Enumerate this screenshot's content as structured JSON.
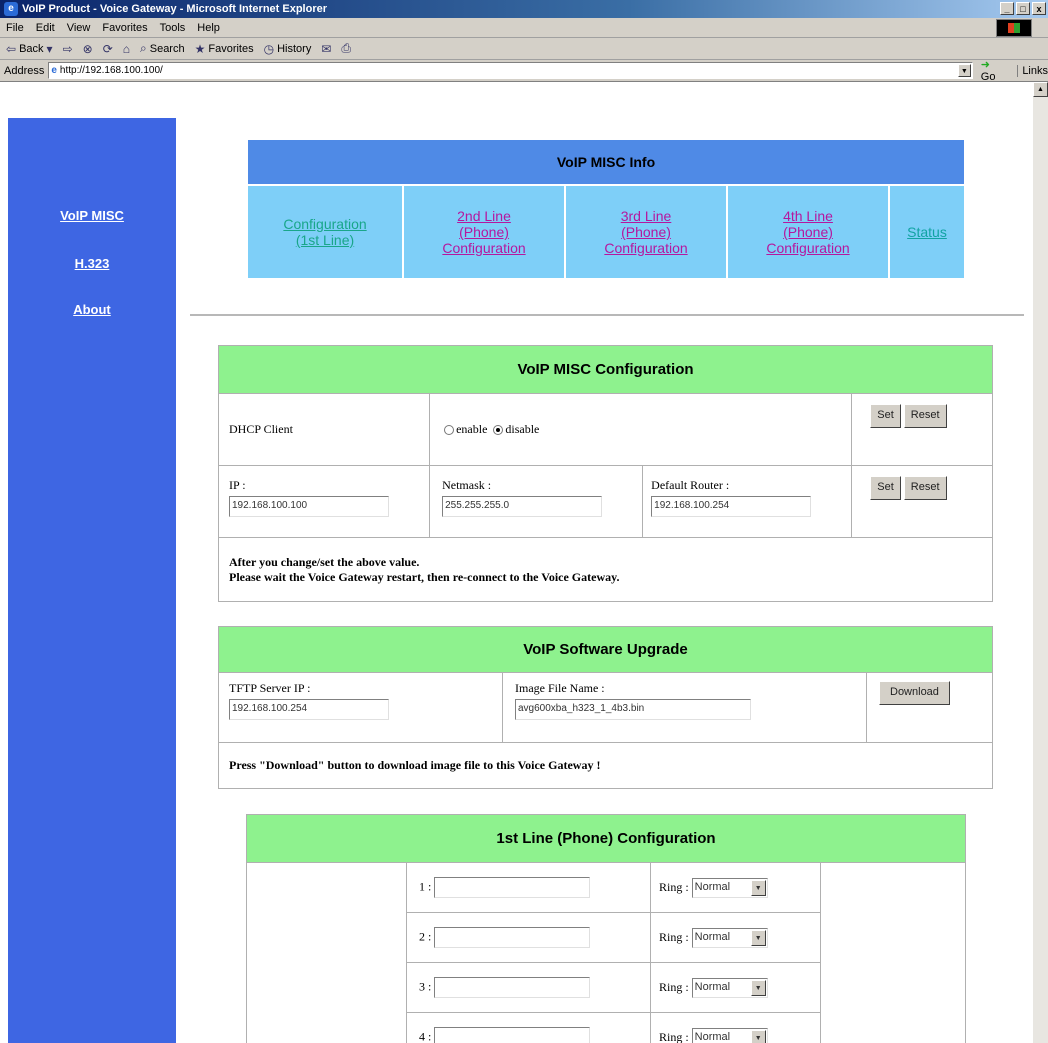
{
  "window": {
    "title": "VoIP Product - Voice Gateway - Microsoft Internet Explorer",
    "controls": [
      "_",
      "□",
      "x"
    ]
  },
  "menu": [
    "File",
    "Edit",
    "View",
    "Favorites",
    "Tools",
    "Help"
  ],
  "toolbar": {
    "back": "Back",
    "search": "Search",
    "favorites": "Favorites",
    "history": "History"
  },
  "address": {
    "label": "Address",
    "url": "http://192.168.100.100/",
    "go": "Go",
    "links": "Links"
  },
  "sidebar": {
    "items": [
      "VoIP MISC",
      "H.323",
      "About"
    ]
  },
  "info": {
    "title": "VoIP MISC Info",
    "tabs": [
      [
        "Configuration",
        "(1st Line)"
      ],
      [
        "2nd Line",
        "(Phone)",
        "Configuration"
      ],
      [
        "3rd Line",
        "(Phone)",
        "Configuration"
      ],
      [
        "4th Line",
        "(Phone)",
        "Configuration"
      ],
      [
        "Status"
      ]
    ]
  },
  "misc_config": {
    "title": "VoIP MISC Configuration",
    "dhcp_label": "DHCP Client",
    "enable_label": "enable",
    "disable_label": "disable",
    "dhcp_selected": "disable",
    "set_label": "Set",
    "reset_label": "Reset",
    "ip_label": "IP :",
    "ip_value": "192.168.100.100",
    "netmask_label": "Netmask :",
    "netmask_value": "255.255.255.0",
    "router_label": "Default Router :",
    "router_value": "192.168.100.254",
    "note_line1": "After you change/set the above value.",
    "note_line2": "Please wait the Voice Gateway restart, then re-connect to the Voice Gateway."
  },
  "upgrade": {
    "title": "VoIP Software Upgrade",
    "tftp_label": "TFTP Server IP :",
    "tftp_value": "192.168.100.254",
    "image_label": "Image File Name :",
    "image_value": "avg600xba_h323_1_4b3.bin",
    "download_label": "Download",
    "note": "Press \"Download\" button to download image file to this Voice Gateway !"
  },
  "line1": {
    "title": "1st Line (Phone) Configuration",
    "rows": [
      {
        "index": "1 :",
        "ring_label": "Ring :",
        "ring_value": "Normal"
      },
      {
        "index": "2 :",
        "ring_label": "Ring :",
        "ring_value": "Normal"
      },
      {
        "index": "3 :",
        "ring_label": "Ring :",
        "ring_value": "Normal"
      },
      {
        "index": "4 :",
        "ring_label": "Ring :",
        "ring_value": "Normal"
      }
    ]
  }
}
